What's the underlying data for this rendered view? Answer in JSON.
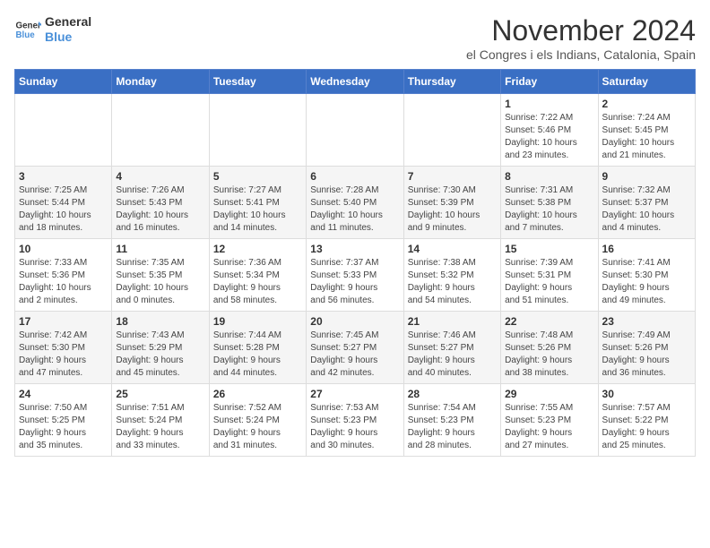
{
  "logo": {
    "text_general": "General",
    "text_blue": "Blue"
  },
  "title": "November 2024",
  "subtitle": "el Congres i els Indians, Catalonia, Spain",
  "headers": [
    "Sunday",
    "Monday",
    "Tuesday",
    "Wednesday",
    "Thursday",
    "Friday",
    "Saturday"
  ],
  "weeks": [
    [
      {
        "day": "",
        "info": ""
      },
      {
        "day": "",
        "info": ""
      },
      {
        "day": "",
        "info": ""
      },
      {
        "day": "",
        "info": ""
      },
      {
        "day": "",
        "info": ""
      },
      {
        "day": "1",
        "info": "Sunrise: 7:22 AM\nSunset: 5:46 PM\nDaylight: 10 hours\nand 23 minutes."
      },
      {
        "day": "2",
        "info": "Sunrise: 7:24 AM\nSunset: 5:45 PM\nDaylight: 10 hours\nand 21 minutes."
      }
    ],
    [
      {
        "day": "3",
        "info": "Sunrise: 7:25 AM\nSunset: 5:44 PM\nDaylight: 10 hours\nand 18 minutes."
      },
      {
        "day": "4",
        "info": "Sunrise: 7:26 AM\nSunset: 5:43 PM\nDaylight: 10 hours\nand 16 minutes."
      },
      {
        "day": "5",
        "info": "Sunrise: 7:27 AM\nSunset: 5:41 PM\nDaylight: 10 hours\nand 14 minutes."
      },
      {
        "day": "6",
        "info": "Sunrise: 7:28 AM\nSunset: 5:40 PM\nDaylight: 10 hours\nand 11 minutes."
      },
      {
        "day": "7",
        "info": "Sunrise: 7:30 AM\nSunset: 5:39 PM\nDaylight: 10 hours\nand 9 minutes."
      },
      {
        "day": "8",
        "info": "Sunrise: 7:31 AM\nSunset: 5:38 PM\nDaylight: 10 hours\nand 7 minutes."
      },
      {
        "day": "9",
        "info": "Sunrise: 7:32 AM\nSunset: 5:37 PM\nDaylight: 10 hours\nand 4 minutes."
      }
    ],
    [
      {
        "day": "10",
        "info": "Sunrise: 7:33 AM\nSunset: 5:36 PM\nDaylight: 10 hours\nand 2 minutes."
      },
      {
        "day": "11",
        "info": "Sunrise: 7:35 AM\nSunset: 5:35 PM\nDaylight: 10 hours\nand 0 minutes."
      },
      {
        "day": "12",
        "info": "Sunrise: 7:36 AM\nSunset: 5:34 PM\nDaylight: 9 hours\nand 58 minutes."
      },
      {
        "day": "13",
        "info": "Sunrise: 7:37 AM\nSunset: 5:33 PM\nDaylight: 9 hours\nand 56 minutes."
      },
      {
        "day": "14",
        "info": "Sunrise: 7:38 AM\nSunset: 5:32 PM\nDaylight: 9 hours\nand 54 minutes."
      },
      {
        "day": "15",
        "info": "Sunrise: 7:39 AM\nSunset: 5:31 PM\nDaylight: 9 hours\nand 51 minutes."
      },
      {
        "day": "16",
        "info": "Sunrise: 7:41 AM\nSunset: 5:30 PM\nDaylight: 9 hours\nand 49 minutes."
      }
    ],
    [
      {
        "day": "17",
        "info": "Sunrise: 7:42 AM\nSunset: 5:30 PM\nDaylight: 9 hours\nand 47 minutes."
      },
      {
        "day": "18",
        "info": "Sunrise: 7:43 AM\nSunset: 5:29 PM\nDaylight: 9 hours\nand 45 minutes."
      },
      {
        "day": "19",
        "info": "Sunrise: 7:44 AM\nSunset: 5:28 PM\nDaylight: 9 hours\nand 44 minutes."
      },
      {
        "day": "20",
        "info": "Sunrise: 7:45 AM\nSunset: 5:27 PM\nDaylight: 9 hours\nand 42 minutes."
      },
      {
        "day": "21",
        "info": "Sunrise: 7:46 AM\nSunset: 5:27 PM\nDaylight: 9 hours\nand 40 minutes."
      },
      {
        "day": "22",
        "info": "Sunrise: 7:48 AM\nSunset: 5:26 PM\nDaylight: 9 hours\nand 38 minutes."
      },
      {
        "day": "23",
        "info": "Sunrise: 7:49 AM\nSunset: 5:26 PM\nDaylight: 9 hours\nand 36 minutes."
      }
    ],
    [
      {
        "day": "24",
        "info": "Sunrise: 7:50 AM\nSunset: 5:25 PM\nDaylight: 9 hours\nand 35 minutes."
      },
      {
        "day": "25",
        "info": "Sunrise: 7:51 AM\nSunset: 5:24 PM\nDaylight: 9 hours\nand 33 minutes."
      },
      {
        "day": "26",
        "info": "Sunrise: 7:52 AM\nSunset: 5:24 PM\nDaylight: 9 hours\nand 31 minutes."
      },
      {
        "day": "27",
        "info": "Sunrise: 7:53 AM\nSunset: 5:23 PM\nDaylight: 9 hours\nand 30 minutes."
      },
      {
        "day": "28",
        "info": "Sunrise: 7:54 AM\nSunset: 5:23 PM\nDaylight: 9 hours\nand 28 minutes."
      },
      {
        "day": "29",
        "info": "Sunrise: 7:55 AM\nSunset: 5:23 PM\nDaylight: 9 hours\nand 27 minutes."
      },
      {
        "day": "30",
        "info": "Sunrise: 7:57 AM\nSunset: 5:22 PM\nDaylight: 9 hours\nand 25 minutes."
      }
    ]
  ]
}
